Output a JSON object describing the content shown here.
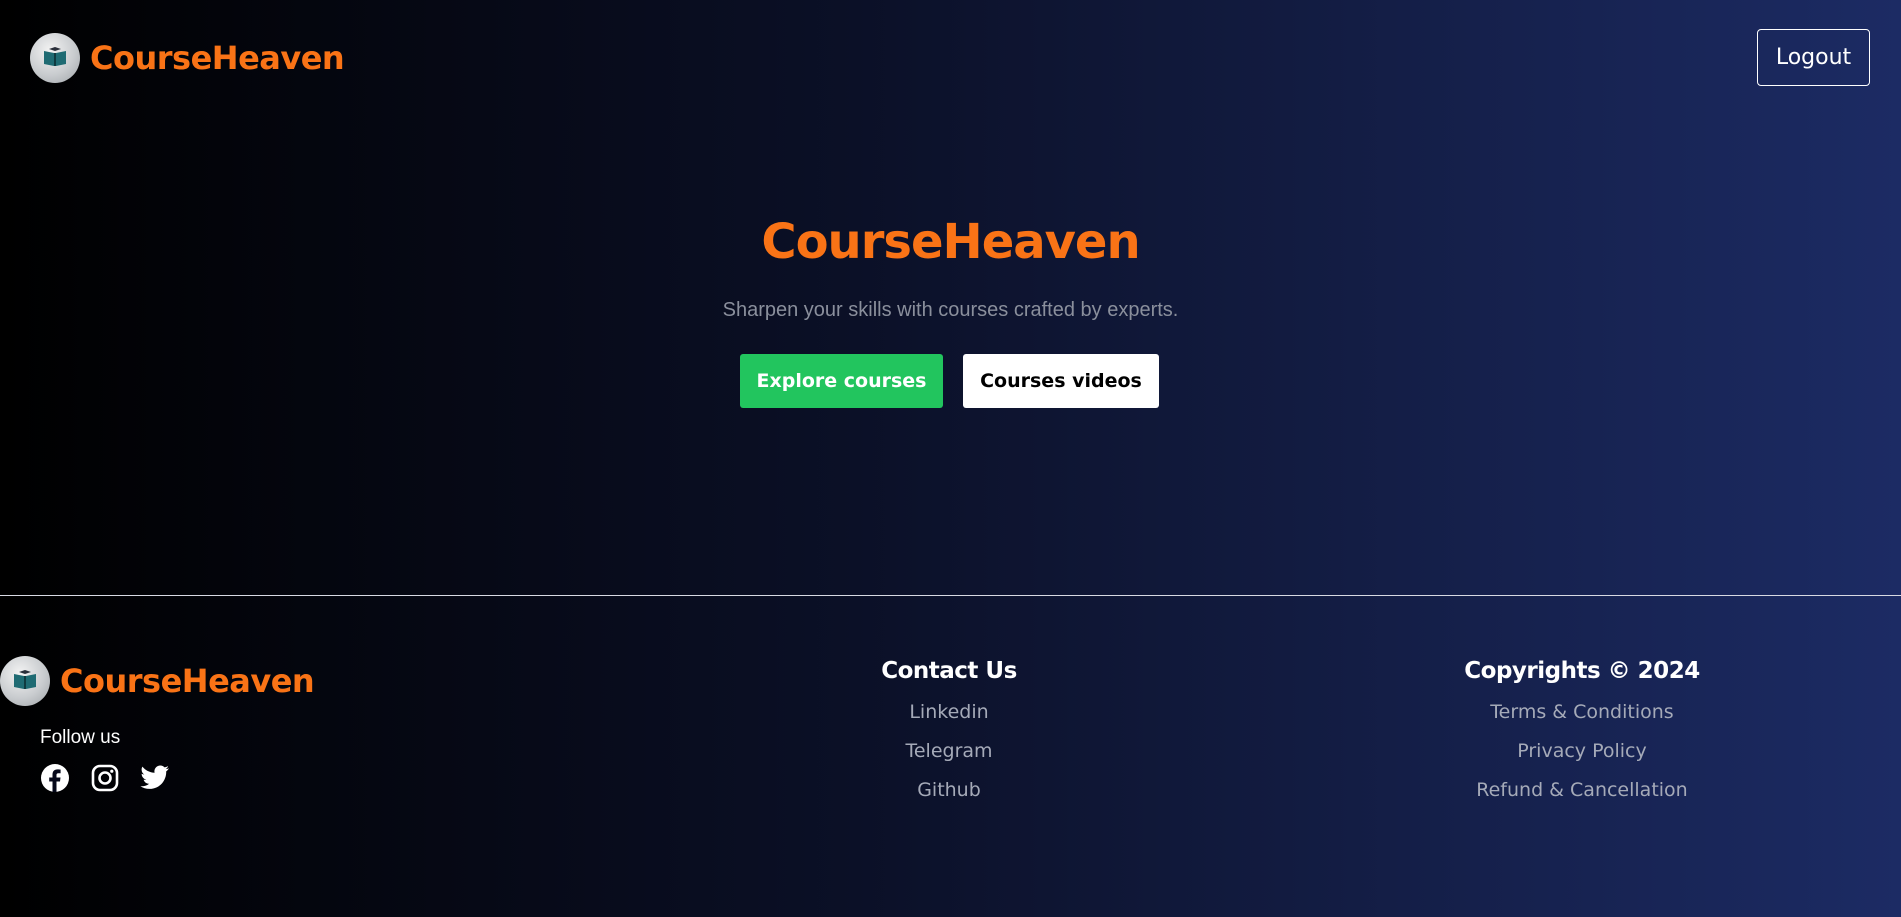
{
  "header": {
    "brand": "CourseHeaven",
    "logout_label": "Logout"
  },
  "hero": {
    "title": "CourseHeaven",
    "subtitle": "Sharpen your skills with courses crafted by experts.",
    "explore_label": "Explore courses",
    "videos_label": "Courses videos"
  },
  "footer": {
    "brand": "CourseHeaven",
    "follow_label": "Follow us",
    "socials": [
      "facebook-icon",
      "instagram-icon",
      "twitter-icon"
    ],
    "contact": {
      "title": "Contact Us",
      "links": [
        "Linkedin",
        "Telegram",
        "Github"
      ]
    },
    "legal": {
      "title": "Copyrights © 2024",
      "links": [
        "Terms & Conditions",
        "Privacy Policy",
        "Refund & Cancellation"
      ]
    }
  },
  "colors": {
    "brand": "#f97316",
    "explore_button": "#22c55e",
    "link_text": "#a5aab8"
  }
}
